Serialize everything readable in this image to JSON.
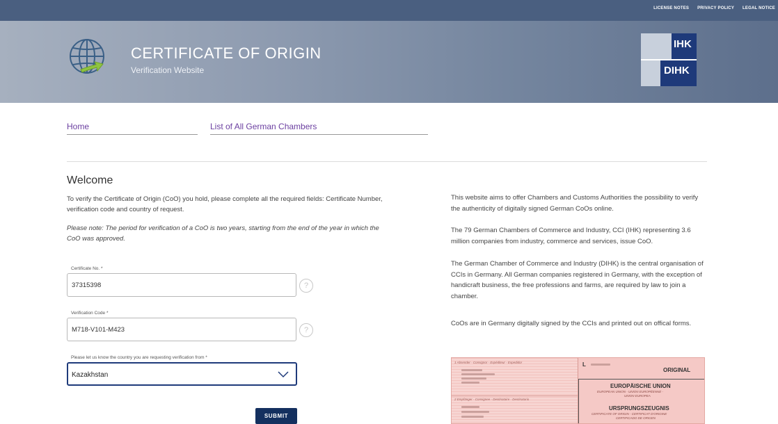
{
  "top_links": [
    "LICENSE NOTES",
    "PRIVACY POLICY",
    "LEGAL NOTICE"
  ],
  "header": {
    "title": "CERTIFICATE OF ORIGIN",
    "subtitle": "Verification Website",
    "logo_top": "IHK",
    "logo_bottom": "DIHK"
  },
  "nav": {
    "home": "Home",
    "chambers": "List of All German Chambers"
  },
  "main": {
    "heading": "Welcome",
    "intro": "To verify the Certificate of Origin (CoO) you hold, please complete all the required fields: Certificate Number, verification code and country of request.",
    "note": "Please note: The period for verification of a CoO is two years, starting from the end of the year in which the CoO was approved."
  },
  "form": {
    "certificate_label": "Certificate No. *",
    "certificate_value": "37315398",
    "code_label": "Verification Code *",
    "code_value": "M718-V101-M423",
    "country_label": "Please let us know the country you are requesting verification from *",
    "country_value": "Kazakhstan",
    "help_symbol": "?",
    "submit": "SUBMIT"
  },
  "info": [
    "This website aims to offer Chambers and Customs Authorities the possibility to verify the authenticity of digitally signed German CoOs online.",
    "The 79 German Chambers of Commerce and Industry, CCI (IHK) representing 3.6 million companies from industry, commerce and services, issue CoO.",
    "The German Chamber of Commerce and Industry (DIHK) is the central organisation of CCIs in Germany. All German companies registered in Germany, with the exception of handicraft business, the free professions and farms, are required by law to join a chamber.",
    "CoOs are in Germany digitally signed by the CCIs and printed out on offical forms."
  ],
  "certificate_image": {
    "field1": "1 Absender - Consignor - Expéditeur - Expedidor",
    "field2": "2 Empfänger - Consignee - Destinataire - Destinatario",
    "letter": "L",
    "original": "ORIGINAL",
    "union": "EUROPÄISCHE UNION",
    "union_sub1": "EUROPEAN UNION - UNION EUROPÉENNE -",
    "union_sub2": "UNION EUROPEA",
    "ursprung": "URSPRUNGSZEUGNIS",
    "ursprung_sub1": "CERTIFICATE OF ORIGIN - CERTIFICAT D'ORIGINE",
    "ursprung_sub2": "CERTIFICADO DE ORIGEN"
  },
  "colors": {
    "topbar": "#4a5f80",
    "link": "#6b3fa0",
    "button": "#14305f",
    "logo_blue": "#1e3a7a"
  }
}
